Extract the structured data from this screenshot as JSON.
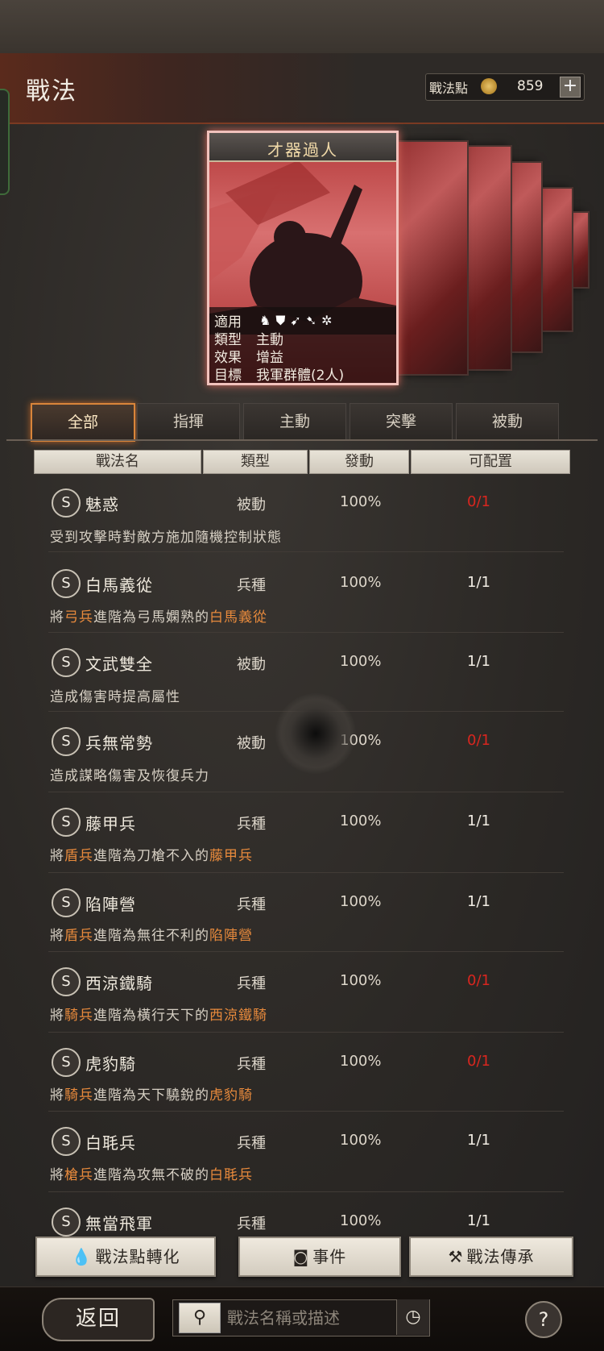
{
  "header": {
    "title": "戰法",
    "points_label": "戰法點",
    "points_icon": "flame-coin-icon",
    "points_value": "859",
    "plus_label": "+"
  },
  "card": {
    "title": "才器過人",
    "rows": [
      {
        "key": "適用",
        "value": ""
      },
      {
        "key": "類型",
        "value": "主動"
      },
      {
        "key": "效果",
        "value": "增益"
      },
      {
        "key": "目標",
        "value": "我軍群體(2人)"
      }
    ],
    "applicable_icons": [
      "cavalry-icon",
      "shield-icon",
      "bow-icon",
      "spear-icon",
      "wheel-icon"
    ]
  },
  "tabs": [
    {
      "label": "全部",
      "active": true
    },
    {
      "label": "指揮",
      "active": false
    },
    {
      "label": "主動",
      "active": false
    },
    {
      "label": "突擊",
      "active": false
    },
    {
      "label": "被動",
      "active": false
    }
  ],
  "columns": [
    "戰法名",
    "類型",
    "發動",
    "可配置"
  ],
  "skills": [
    {
      "grade": "S",
      "name": "魅惑",
      "type": "被動",
      "rate": "100%",
      "avail": "0/1",
      "desc": [
        "受到攻擊時對敵方施加隨機控制狀態"
      ]
    },
    {
      "grade": "S",
      "name": "白馬義從",
      "type": "兵種",
      "rate": "100%",
      "avail": "1/1",
      "desc": [
        "將",
        "弓兵",
        "進階為弓馬嫻熟的",
        "白馬義從"
      ]
    },
    {
      "grade": "S",
      "name": "文武雙全",
      "type": "被動",
      "rate": "100%",
      "avail": "1/1",
      "desc": [
        "造成傷害時提高屬性"
      ]
    },
    {
      "grade": "S",
      "name": "兵無常勢",
      "type": "被動",
      "rate": "100%",
      "avail": "0/1",
      "desc": [
        "造成謀略傷害及恢復兵力"
      ]
    },
    {
      "grade": "S",
      "name": "藤甲兵",
      "type": "兵種",
      "rate": "100%",
      "avail": "1/1",
      "desc": [
        "將",
        "盾兵",
        "進階為刀槍不入的",
        "藤甲兵"
      ]
    },
    {
      "grade": "S",
      "name": "陷陣營",
      "type": "兵種",
      "rate": "100%",
      "avail": "1/1",
      "desc": [
        "將",
        "盾兵",
        "進階為無往不利的",
        "陷陣營"
      ]
    },
    {
      "grade": "S",
      "name": "西涼鐵騎",
      "type": "兵種",
      "rate": "100%",
      "avail": "0/1",
      "desc": [
        "將",
        "騎兵",
        "進階為橫行天下的",
        "西涼鐵騎"
      ]
    },
    {
      "grade": "S",
      "name": "虎豹騎",
      "type": "兵種",
      "rate": "100%",
      "avail": "0/1",
      "desc": [
        "將",
        "騎兵",
        "進階為天下驍銳的",
        "虎豹騎"
      ]
    },
    {
      "grade": "S",
      "name": "白毦兵",
      "type": "兵種",
      "rate": "100%",
      "avail": "1/1",
      "desc": [
        "將",
        "槍兵",
        "進階為攻無不破的",
        "白毦兵"
      ]
    },
    {
      "grade": "S",
      "name": "無當飛軍",
      "type": "兵種",
      "rate": "100%",
      "avail": "1/1",
      "desc": []
    }
  ],
  "buttons": {
    "convert": "戰法點轉化",
    "events": "事件",
    "inherit": "戰法傳承"
  },
  "footer": {
    "back": "返回",
    "search_placeholder": "戰法名稱或描述",
    "help": "?"
  },
  "colors": {
    "accent_orange": "#e88a3c",
    "unavailable_red": "#d9261f",
    "active_tab_border": "#d9853a"
  }
}
